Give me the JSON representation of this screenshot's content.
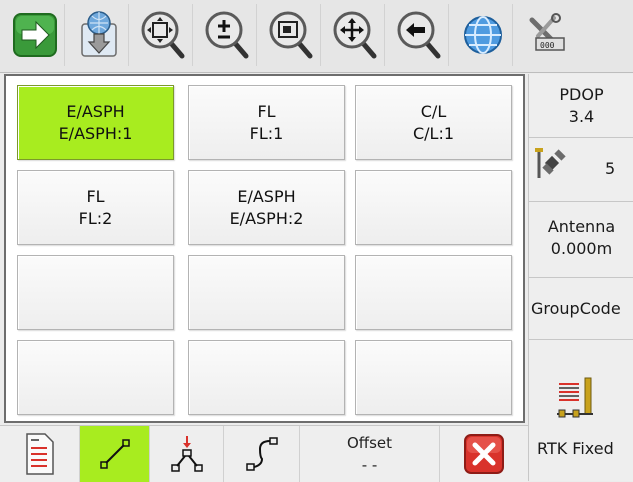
{
  "toolbar": {
    "buttons": [
      {
        "icon": "arrow-right-icon"
      },
      {
        "icon": "download-globe-icon"
      },
      {
        "icon": "zoom-fit-icon"
      },
      {
        "icon": "zoom-in-out-icon"
      },
      {
        "icon": "zoom-window-icon"
      },
      {
        "icon": "pan-icon"
      },
      {
        "icon": "zoom-previous-icon"
      },
      {
        "icon": "globe-icon"
      },
      {
        "icon": "tools-icon"
      }
    ]
  },
  "grid": {
    "cells": [
      {
        "line1": "E/ASPH",
        "line2": "E/ASPH:1",
        "active": true
      },
      {
        "line1": "FL",
        "line2": "FL:1",
        "active": false
      },
      {
        "line1": "C/L",
        "line2": "C/L:1",
        "active": false
      },
      {
        "line1": "FL",
        "line2": "FL:2",
        "active": false
      },
      {
        "line1": "E/ASPH",
        "line2": "E/ASPH:2",
        "active": false
      },
      {
        "line1": "",
        "line2": "",
        "active": false
      },
      {
        "line1": "",
        "line2": "",
        "active": false
      },
      {
        "line1": "",
        "line2": "",
        "active": false
      },
      {
        "line1": "",
        "line2": "",
        "active": false
      },
      {
        "line1": "",
        "line2": "",
        "active": false
      },
      {
        "line1": "",
        "line2": "",
        "active": false
      },
      {
        "line1": "",
        "line2": "",
        "active": false
      }
    ]
  },
  "side": {
    "pdop_label": "PDOP",
    "pdop_value": "3.4",
    "satellites": "5",
    "antenna_label": "Antenna",
    "antenna_value": "0.000m",
    "group_code": "GroupCode",
    "rtk_status": "RTK Fixed"
  },
  "bottom": {
    "offset_label": "Offset",
    "offset_value": "- -"
  },
  "colors": {
    "accent_green": "#a8ec1f",
    "close_red": "#d9322b"
  }
}
